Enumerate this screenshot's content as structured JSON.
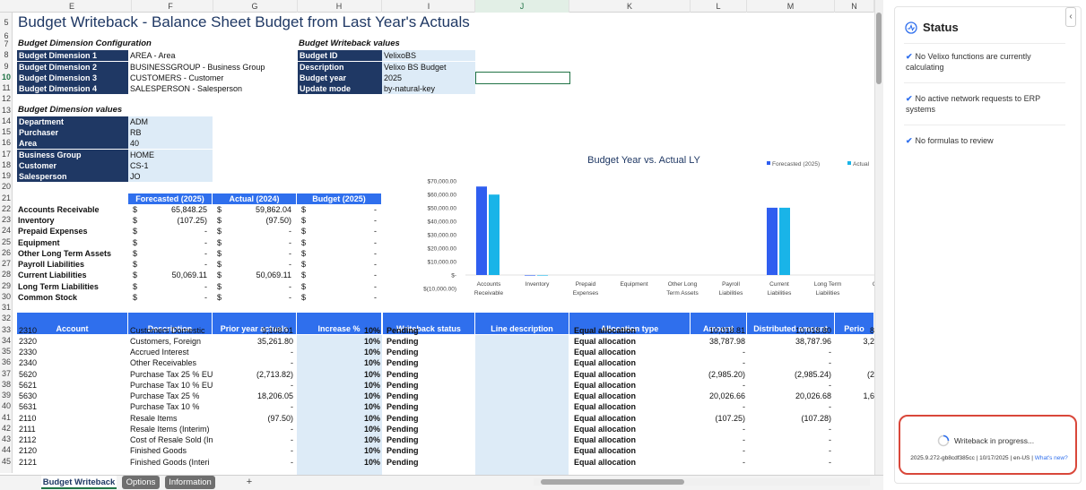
{
  "columns": [
    "E",
    "F",
    "G",
    "H",
    "I",
    "J",
    "K",
    "L",
    "M",
    "N"
  ],
  "rows": [
    "5",
    "6",
    "7",
    "8",
    "9",
    "10",
    "11",
    "12",
    "13",
    "14",
    "15",
    "16",
    "17",
    "18",
    "19",
    "20",
    "21",
    "22",
    "23",
    "24",
    "25",
    "26",
    "27",
    "28",
    "29",
    "30",
    "31",
    "32",
    "33",
    "34",
    "35",
    "36",
    "37",
    "38",
    "39",
    "40",
    "41",
    "42",
    "43",
    "44",
    "45"
  ],
  "title": "Budget Writeback - Balance Sheet Budget from Last Year's Actuals",
  "config": {
    "header": "Budget Dimension Configuration",
    "items": [
      {
        "key": "Budget Dimension 1",
        "value": "AREA - Area"
      },
      {
        "key": "Budget Dimension 2",
        "value": "BUSINESSGROUP - Business Group"
      },
      {
        "key": "Budget Dimension 3",
        "value": "CUSTOMERS - Customer"
      },
      {
        "key": "Budget Dimension 4",
        "value": "SALESPERSON - Salesperson"
      }
    ]
  },
  "writeback": {
    "header": "Budget Writeback values",
    "items": [
      {
        "key": "Budget ID",
        "value": "VelixoBS"
      },
      {
        "key": "Description",
        "value": "Velixo BS Budget"
      },
      {
        "key": "Budget year",
        "value": "2025"
      },
      {
        "key": "Update mode",
        "value": "by-natural-key"
      }
    ]
  },
  "dimvalues": {
    "header": "Budget Dimension values",
    "items": [
      {
        "key": "Department",
        "value": "ADM"
      },
      {
        "key": "Purchaser",
        "value": "RB"
      },
      {
        "key": "Area",
        "value": "40"
      },
      {
        "key": "Business Group",
        "value": "HOME"
      },
      {
        "key": "Customer",
        "value": "CS-1"
      },
      {
        "key": "Salesperson",
        "value": "JO"
      }
    ]
  },
  "summary": {
    "headers": [
      "Forecasted (2025)",
      "Actual (2024)",
      "Budget (2025)"
    ],
    "currency": "$",
    "rows": [
      {
        "label": "Accounts Receivable",
        "f": "65,848.25",
        "a": "59,862.04",
        "b": "-"
      },
      {
        "label": "Inventory",
        "f": "(107.25)",
        "a": "(97.50)",
        "b": "-"
      },
      {
        "label": "Prepaid Expenses",
        "f": "-",
        "a": "-",
        "b": "-"
      },
      {
        "label": "Equipment",
        "f": "-",
        "a": "-",
        "b": "-"
      },
      {
        "label": "Other Long Term Assets",
        "f": "-",
        "a": "-",
        "b": "-"
      },
      {
        "label": "Payroll Liabilities",
        "f": "-",
        "a": "-",
        "b": "-"
      },
      {
        "label": "Current Liabilities",
        "f": "50,069.11",
        "a": "50,069.11",
        "b": "-"
      },
      {
        "label": "Long Term Liabilities",
        "f": "-",
        "a": "-",
        "b": "-"
      },
      {
        "label": "Common Stock",
        "f": "-",
        "a": "-",
        "b": "-"
      }
    ]
  },
  "chart_data": {
    "type": "bar",
    "title": "Budget Year vs. Actual LY",
    "categories": [
      "Accounts Receivable",
      "Inventory",
      "Prepaid Expenses",
      "Equipment",
      "Other Long Term Assets",
      "Payroll Liabilities",
      "Current Liabilities",
      "Long Term Liabilities",
      "Co"
    ],
    "series": [
      {
        "name": "Forecasted (2025)",
        "color": "#2f5ef0",
        "values": [
          65848.25,
          -107.25,
          0,
          0,
          0,
          0,
          50069.11,
          0,
          0
        ]
      },
      {
        "name": "Actual",
        "color": "#19b4e8",
        "values": [
          59862.04,
          -97.5,
          0,
          0,
          0,
          0,
          50069.11,
          0,
          0
        ]
      }
    ],
    "yticks": [
      "$70,000.00",
      "$60,000.00",
      "$50,000.00",
      "$40,000.00",
      "$30,000.00",
      "$20,000.00",
      "$10,000.00",
      "$-",
      "$(10,000.00)"
    ],
    "ylim": [
      -10000,
      70000
    ],
    "legend": "top-right"
  },
  "table": {
    "headers": [
      "Account",
      "Description",
      "Prior year actuals",
      "Increase %",
      "Writeback status",
      "Line description",
      "Allocation type",
      "Amount",
      "Distributed amount",
      "Perio"
    ],
    "rows": [
      {
        "acct": "2310",
        "desc": "Customers Domestic",
        "prior": "9,108.01",
        "inc": "10%",
        "status": "Pending",
        "alloc": "Equal allocation",
        "amt": "10,018.81",
        "dist": "10,018.80",
        "per": "8"
      },
      {
        "acct": "2320",
        "desc": "Customers, Foreign",
        "prior": "35,261.80",
        "inc": "10%",
        "status": "Pending",
        "alloc": "Equal allocation",
        "amt": "38,787.98",
        "dist": "38,787.96",
        "per": "3,2"
      },
      {
        "acct": "2330",
        "desc": "Accrued Interest",
        "prior": "-",
        "inc": "10%",
        "status": "Pending",
        "alloc": "Equal allocation",
        "amt": "-",
        "dist": "-",
        "per": ""
      },
      {
        "acct": "2340",
        "desc": "Other Receivables",
        "prior": "-",
        "inc": "10%",
        "status": "Pending",
        "alloc": "Equal allocation",
        "amt": "-",
        "dist": "-",
        "per": ""
      },
      {
        "acct": "5620",
        "desc": "Purchase Tax 25 % EU",
        "prior": "(2,713.82)",
        "inc": "10%",
        "status": "Pending",
        "alloc": "Equal allocation",
        "amt": "(2,985.20)",
        "dist": "(2,985.24)",
        "per": "(2"
      },
      {
        "acct": "5621",
        "desc": "Purchase Tax 10 % EU",
        "prior": "-",
        "inc": "10%",
        "status": "Pending",
        "alloc": "Equal allocation",
        "amt": "-",
        "dist": "-",
        "per": ""
      },
      {
        "acct": "5630",
        "desc": "Purchase Tax 25 %",
        "prior": "18,206.05",
        "inc": "10%",
        "status": "Pending",
        "alloc": "Equal allocation",
        "amt": "20,026.66",
        "dist": "20,026.68",
        "per": "1,6"
      },
      {
        "acct": "5631",
        "desc": "Purchase Tax 10 %",
        "prior": "-",
        "inc": "10%",
        "status": "Pending",
        "alloc": "Equal allocation",
        "amt": "-",
        "dist": "-",
        "per": ""
      },
      {
        "acct": "2110",
        "desc": "Resale Items",
        "prior": "(97.50)",
        "inc": "10%",
        "status": "Pending",
        "alloc": "Equal allocation",
        "amt": "(107.25)",
        "dist": "(107.28)",
        "per": ""
      },
      {
        "acct": "2111",
        "desc": "Resale Items (Interim)",
        "prior": "-",
        "inc": "10%",
        "status": "Pending",
        "alloc": "Equal allocation",
        "amt": "-",
        "dist": "-",
        "per": ""
      },
      {
        "acct": "2112",
        "desc": "Cost of Resale Sold (In",
        "prior": "-",
        "inc": "10%",
        "status": "Pending",
        "alloc": "Equal allocation",
        "amt": "-",
        "dist": "-",
        "per": ""
      },
      {
        "acct": "2120",
        "desc": "Finished Goods",
        "prior": "-",
        "inc": "10%",
        "status": "Pending",
        "alloc": "Equal allocation",
        "amt": "-",
        "dist": "-",
        "per": ""
      },
      {
        "acct": "2121",
        "desc": "Finished Goods (Interi",
        "prior": "-",
        "inc": "10%",
        "status": "Pending",
        "alloc": "Equal allocation",
        "amt": "-",
        "dist": "-",
        "per": ""
      }
    ]
  },
  "tabs": [
    "Budget Writeback",
    "Options",
    "Information"
  ],
  "add_sheet": "+",
  "panel": {
    "title": "Status",
    "collapse": "‹",
    "messages": [
      "No Velixo functions are currently calculating",
      "No active network requests to ERP systems",
      "No formulas to review"
    ],
    "progress": "Writeback in progress...",
    "version": "2025.9.272-gb8cdf385cc | 10/17/2025 | en-US |",
    "whats_new": "What's new?"
  }
}
